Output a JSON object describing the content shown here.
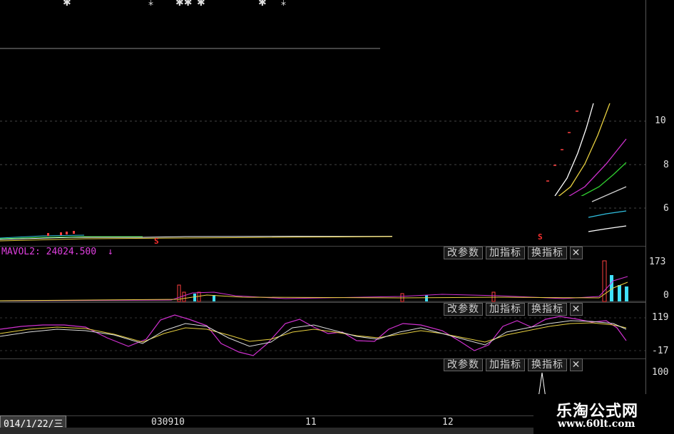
{
  "price_axis": {
    "ticks": [
      "10",
      "8",
      "6"
    ]
  },
  "volume_panel": {
    "label": "MAVOL2: 24024.500",
    "arrow": "↓",
    "ticks": [
      "173",
      "0"
    ]
  },
  "osc_panel": {
    "ticks": [
      "119",
      "-17"
    ]
  },
  "third_panel": {
    "ticks": [
      "100"
    ]
  },
  "toolbar": {
    "change_params": "改参数",
    "add_indicator": "加指标",
    "swap_indicator": "换指标",
    "close": "✕"
  },
  "xaxis": {
    "date": "014/1/22/三",
    "labels": [
      "030910",
      "11",
      "12"
    ]
  },
  "markers": {
    "sell": "S"
  },
  "watermark": {
    "title": "乐淘公式网",
    "url": "www.60lt.com"
  },
  "colors": {
    "ma_white": "#ffffff",
    "ma_yellow": "#e8d040",
    "ma_magenta": "#d030d0",
    "ma_green": "#30d030",
    "ma_cyan": "#30c0e0",
    "bar_red": "#ff4040",
    "bar_cyan": "#40e0ff"
  }
}
